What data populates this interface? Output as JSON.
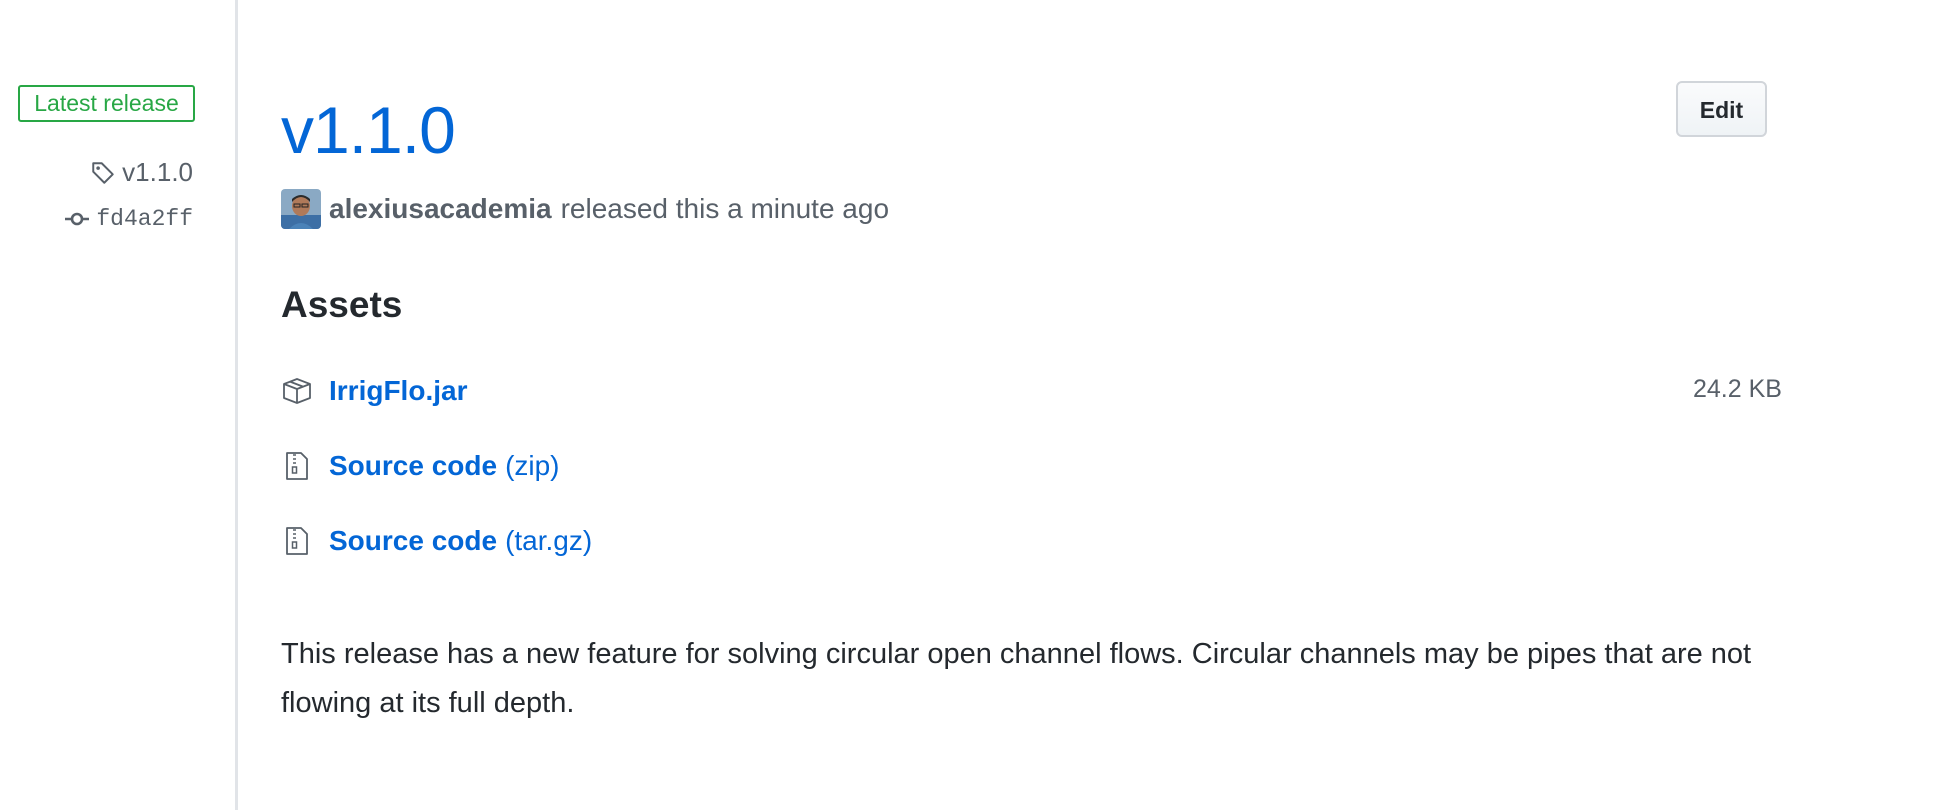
{
  "sidebar": {
    "badge": "Latest release",
    "tag": "v1.1.0",
    "commit": "fd4a2ff"
  },
  "release": {
    "title": "v1.1.0",
    "edit_label": "Edit",
    "author": "alexiusacademia",
    "byline_suffix": "released this a minute ago"
  },
  "assets": {
    "heading": "Assets",
    "items": [
      {
        "icon": "package-icon",
        "name": "IrrigFlo.jar",
        "size": "24.2 KB"
      },
      {
        "icon": "file-zip-icon",
        "name": "Source code",
        "ext": "(zip)"
      },
      {
        "icon": "file-zip-icon",
        "name": "Source code",
        "ext": "(tar.gz)"
      }
    ]
  },
  "notes": {
    "body": "This release has a new feature for solving circular open channel flows. Circular channels may be pipes that are not flowing at its full depth."
  },
  "colors": {
    "link": "#0366d6",
    "badge_green": "#28a745",
    "muted": "#586069"
  }
}
